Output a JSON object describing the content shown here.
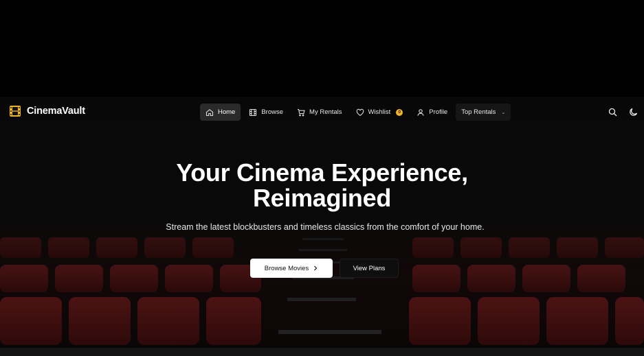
{
  "brand": {
    "name": "CinemaVault",
    "accent": "#f0b429"
  },
  "nav": {
    "items": [
      {
        "label": "Home",
        "icon": "home-icon",
        "active": true
      },
      {
        "label": "Browse",
        "icon": "film-icon"
      },
      {
        "label": "My Rentals",
        "icon": "cart-icon"
      },
      {
        "label": "Wishlist",
        "icon": "heart-icon",
        "badge": "0"
      },
      {
        "label": "Profile",
        "icon": "user-icon"
      },
      {
        "label": "Top Rentals",
        "icon": "chevron-down-icon"
      }
    ],
    "right_icons": [
      "search-icon",
      "moon-icon"
    ]
  },
  "hero": {
    "title_line1": "Your Cinema Experience,",
    "title_line2": "Reimagined",
    "subtitle": "Stream the latest blockbusters and timeless classics from the comfort of your home.",
    "primary_button": "Browse Movies",
    "secondary_button": "View Plans"
  }
}
